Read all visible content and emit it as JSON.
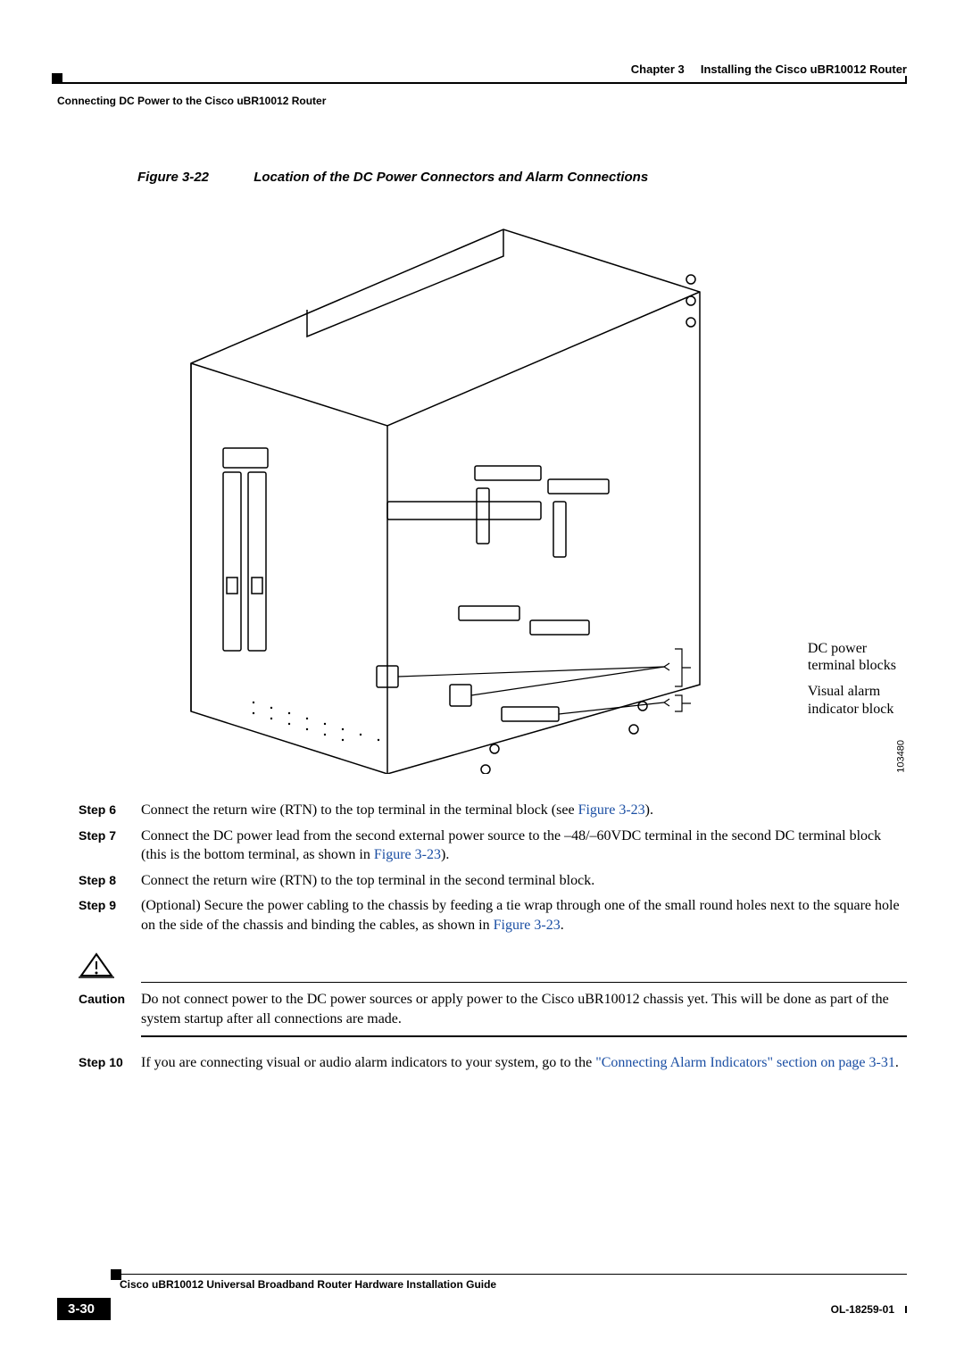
{
  "header": {
    "chapter_prefix": "Chapter 3",
    "chapter_title": "Installing the Cisco uBR10012 Router",
    "section": "Connecting DC Power to the Cisco uBR10012 Router"
  },
  "figure": {
    "number": "Figure 3-22",
    "title": "Location of the DC Power Connectors and Alarm Connections",
    "callouts": {
      "dc_power_l1": "DC power",
      "dc_power_l2": "terminal blocks",
      "visual_alarm_l1": "Visual alarm",
      "visual_alarm_l2": "indicator block"
    },
    "image_id": "103480"
  },
  "steps": {
    "s6": {
      "label": "Step 6",
      "text_a": "Connect the return wire (RTN) to the top terminal in the terminal block (see ",
      "link": "Figure 3-23",
      "text_b": ")."
    },
    "s7": {
      "label": "Step 7",
      "text_a": "Connect the DC power lead from the second external power source to the –48/–60VDC terminal in the second DC terminal block (this is the bottom terminal, as shown in ",
      "link": "Figure 3-23",
      "text_b": ")."
    },
    "s8": {
      "label": "Step 8",
      "text": "Connect the return wire (RTN) to the top terminal in the second terminal block."
    },
    "s9": {
      "label": "Step 9",
      "text_a": "(Optional) Secure the power cabling to the chassis by feeding a tie wrap through one of the small round holes next to the square hole on the side of the chassis and binding the cables, as shown in ",
      "link": "Figure 3-23",
      "text_b": "."
    },
    "s10": {
      "label": "Step 10",
      "text_a": "If you are connecting visual or audio alarm indicators to your system, go to the ",
      "link": "\"Connecting Alarm Indicators\" section on page 3-31",
      "text_b": "."
    }
  },
  "caution": {
    "label": "Caution",
    "text": "Do not connect power to the DC power sources or apply power to the Cisco uBR10012 chassis yet. This will be done as part of the system startup after all connections are made."
  },
  "footer": {
    "guide": "Cisco uBR10012 Universal Broadband Router Hardware Installation Guide",
    "page": "3-30",
    "docid": "OL-18259-01"
  }
}
